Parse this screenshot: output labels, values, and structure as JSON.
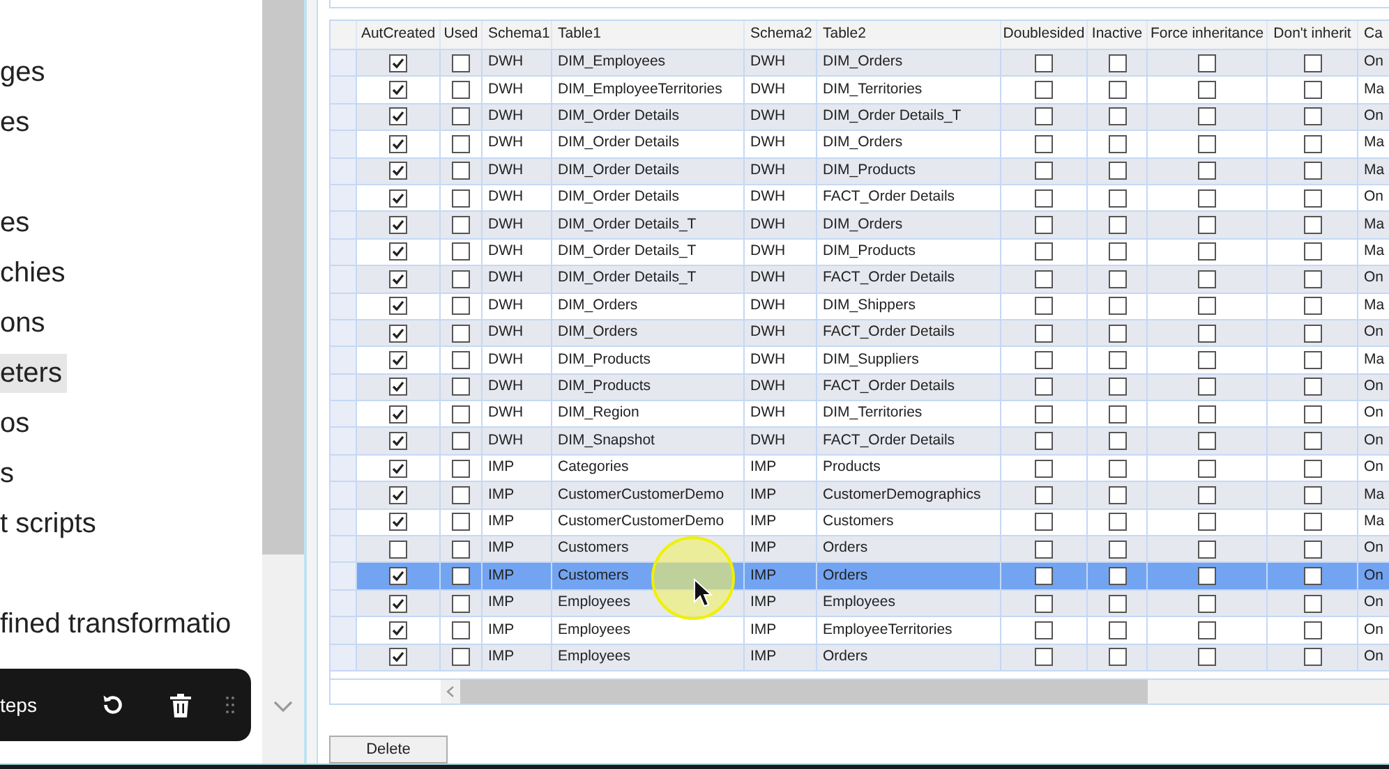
{
  "sidebar": {
    "groups": [
      {
        "items": [
          {
            "label": "ges",
            "selected": false
          },
          {
            "label": "es",
            "selected": false
          }
        ]
      },
      {
        "items": [
          {
            "label": "es",
            "selected": false
          },
          {
            "label": "chies",
            "selected": false
          },
          {
            "label": "ons",
            "selected": false
          },
          {
            "label": "eters",
            "selected": true
          },
          {
            "label": "os",
            "selected": false
          },
          {
            "label": "s",
            "selected": false
          },
          {
            "label": "t scripts",
            "selected": false
          }
        ]
      },
      {
        "items": [
          {
            "label": "fined transformatio",
            "selected": false
          }
        ]
      }
    ]
  },
  "floating_toolbar": {
    "label": "teps"
  },
  "table": {
    "columns": [
      {
        "label": "AutCreated",
        "kind": "check"
      },
      {
        "label": "Used",
        "kind": "check"
      },
      {
        "label": "Schema1",
        "kind": "text"
      },
      {
        "label": "Table1",
        "kind": "text"
      },
      {
        "label": "Schema2",
        "kind": "text"
      },
      {
        "label": "Table2",
        "kind": "text"
      },
      {
        "label": "Doublesided",
        "kind": "check"
      },
      {
        "label": "Inactive",
        "kind": "check"
      },
      {
        "label": "Force inheritance",
        "kind": "check"
      },
      {
        "label": "Don't inherit",
        "kind": "check"
      },
      {
        "label": "Ca",
        "kind": "text"
      }
    ],
    "rows": [
      {
        "selected": false,
        "cells": [
          true,
          false,
          "DWH",
          "DIM_Employees",
          "DWH",
          "DIM_Orders",
          false,
          false,
          false,
          false,
          "On"
        ]
      },
      {
        "selected": false,
        "cells": [
          true,
          false,
          "DWH",
          "DIM_EmployeeTerritories",
          "DWH",
          "DIM_Territories",
          false,
          false,
          false,
          false,
          "Ma"
        ]
      },
      {
        "selected": false,
        "cells": [
          true,
          false,
          "DWH",
          "DIM_Order Details",
          "DWH",
          "DIM_Order Details_T",
          false,
          false,
          false,
          false,
          "On"
        ]
      },
      {
        "selected": false,
        "cells": [
          true,
          false,
          "DWH",
          "DIM_Order Details",
          "DWH",
          "DIM_Orders",
          false,
          false,
          false,
          false,
          "Ma"
        ]
      },
      {
        "selected": false,
        "cells": [
          true,
          false,
          "DWH",
          "DIM_Order Details",
          "DWH",
          "DIM_Products",
          false,
          false,
          false,
          false,
          "Ma"
        ]
      },
      {
        "selected": false,
        "cells": [
          true,
          false,
          "DWH",
          "DIM_Order Details",
          "DWH",
          "FACT_Order Details",
          false,
          false,
          false,
          false,
          "On"
        ]
      },
      {
        "selected": false,
        "cells": [
          true,
          false,
          "DWH",
          "DIM_Order Details_T",
          "DWH",
          "DIM_Orders",
          false,
          false,
          false,
          false,
          "Ma"
        ]
      },
      {
        "selected": false,
        "cells": [
          true,
          false,
          "DWH",
          "DIM_Order Details_T",
          "DWH",
          "DIM_Products",
          false,
          false,
          false,
          false,
          "Ma"
        ]
      },
      {
        "selected": false,
        "cells": [
          true,
          false,
          "DWH",
          "DIM_Order Details_T",
          "DWH",
          "FACT_Order Details",
          false,
          false,
          false,
          false,
          "On"
        ]
      },
      {
        "selected": false,
        "cells": [
          true,
          false,
          "DWH",
          "DIM_Orders",
          "DWH",
          "DIM_Shippers",
          false,
          false,
          false,
          false,
          "Ma"
        ]
      },
      {
        "selected": false,
        "cells": [
          true,
          false,
          "DWH",
          "DIM_Orders",
          "DWH",
          "FACT_Order Details",
          false,
          false,
          false,
          false,
          "On"
        ]
      },
      {
        "selected": false,
        "cells": [
          true,
          false,
          "DWH",
          "DIM_Products",
          "DWH",
          "DIM_Suppliers",
          false,
          false,
          false,
          false,
          "Ma"
        ]
      },
      {
        "selected": false,
        "cells": [
          true,
          false,
          "DWH",
          "DIM_Products",
          "DWH",
          "FACT_Order Details",
          false,
          false,
          false,
          false,
          "On"
        ]
      },
      {
        "selected": false,
        "cells": [
          true,
          false,
          "DWH",
          "DIM_Region",
          "DWH",
          "DIM_Territories",
          false,
          false,
          false,
          false,
          "On"
        ]
      },
      {
        "selected": false,
        "cells": [
          true,
          false,
          "DWH",
          "DIM_Snapshot",
          "DWH",
          "FACT_Order Details",
          false,
          false,
          false,
          false,
          "On"
        ]
      },
      {
        "selected": false,
        "cells": [
          true,
          false,
          "IMP",
          "Categories",
          "IMP",
          "Products",
          false,
          false,
          false,
          false,
          "On"
        ]
      },
      {
        "selected": false,
        "cells": [
          true,
          false,
          "IMP",
          "CustomerCustomerDemo",
          "IMP",
          "CustomerDemographics",
          false,
          false,
          false,
          false,
          "Ma"
        ]
      },
      {
        "selected": false,
        "cells": [
          true,
          false,
          "IMP",
          "CustomerCustomerDemo",
          "IMP",
          "Customers",
          false,
          false,
          false,
          false,
          "Ma"
        ]
      },
      {
        "selected": false,
        "cells": [
          false,
          false,
          "IMP",
          "Customers",
          "IMP",
          "Orders",
          false,
          false,
          false,
          false,
          "On"
        ]
      },
      {
        "selected": true,
        "cells": [
          true,
          false,
          "IMP",
          "Customers",
          "IMP",
          "Orders",
          false,
          false,
          false,
          false,
          "On"
        ]
      },
      {
        "selected": false,
        "cells": [
          true,
          false,
          "IMP",
          "Employees",
          "IMP",
          "Employees",
          false,
          false,
          false,
          false,
          "On"
        ]
      },
      {
        "selected": false,
        "cells": [
          true,
          false,
          "IMP",
          "Employees",
          "IMP",
          "EmployeeTerritories",
          false,
          false,
          false,
          false,
          "On"
        ]
      },
      {
        "selected": false,
        "cells": [
          true,
          false,
          "IMP",
          "Employees",
          "IMP",
          "Orders",
          false,
          false,
          false,
          false,
          "On"
        ]
      }
    ]
  },
  "delete_button": {
    "label": "Delete"
  }
}
